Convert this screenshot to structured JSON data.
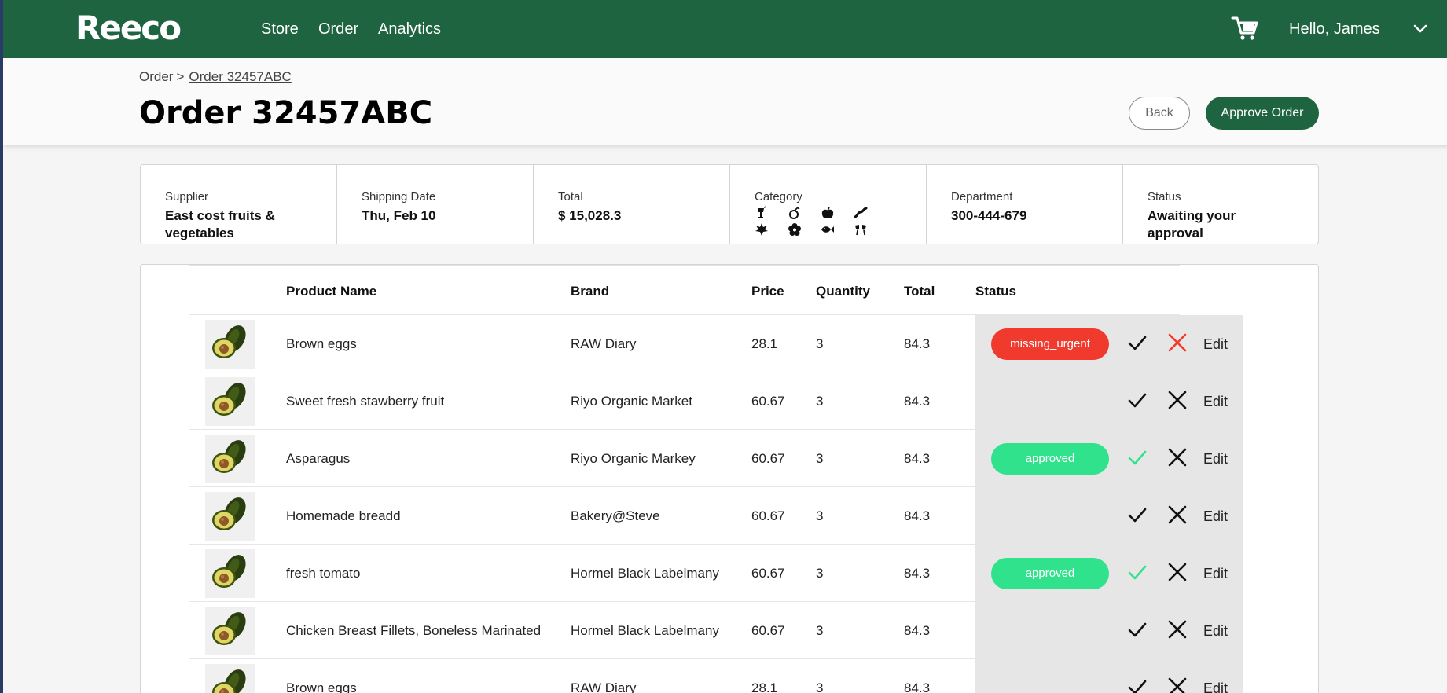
{
  "nav": {
    "logo": "Reeco",
    "links": [
      "Store",
      "Order",
      "Analytics"
    ],
    "greeting": "Hello, James"
  },
  "breadcrumb": {
    "root": "Order",
    "separator": ">",
    "current": "Order 32457ABC"
  },
  "page": {
    "title": "Order 32457ABC",
    "back_label": "Back",
    "approve_label": "Approve Order"
  },
  "summary": {
    "supplier_label": "Supplier",
    "supplier_value": "East cost fruits & vegetables",
    "shipping_label": "Shipping Date",
    "shipping_value": "Thu, Feb 10",
    "total_label": "Total",
    "total_value": "$ 15,028.3",
    "category_label": "Category",
    "category_icons": [
      "drink-icon",
      "fruit-icon",
      "apple-icon",
      "bacon-icon",
      "leaf-icon",
      "flower-icon",
      "fish-icon",
      "cheers-icon"
    ],
    "department_label": "Department",
    "department_value": "300-444-679",
    "status_label": "Status",
    "status_value": "Awaiting your approval"
  },
  "table": {
    "headers": {
      "name": "Product Name",
      "brand": "Brand",
      "price": "Price",
      "quantity": "Quantity",
      "total": "Total",
      "status": "Status"
    },
    "edit_label": "Edit",
    "rows": [
      {
        "name": "Brown eggs",
        "brand": "RAW Diary",
        "price": "28.1",
        "quantity": "3",
        "total": "84.3",
        "status": "missing_urgent"
      },
      {
        "name": "Sweet fresh stawberry fruit",
        "brand": "Riyo Organic Market",
        "price": "60.67",
        "quantity": "3",
        "total": "84.3",
        "status": ""
      },
      {
        "name": "Asparagus",
        "brand": "Riyo Organic Markey",
        "price": "60.67",
        "quantity": "3",
        "total": "84.3",
        "status": "approved"
      },
      {
        "name": "Homemade breadd",
        "brand": "Bakery@Steve",
        "price": "60.67",
        "quantity": "3",
        "total": "84.3",
        "status": ""
      },
      {
        "name": "fresh tomato",
        "brand": "Hormel Black Labelmany",
        "price": "60.67",
        "quantity": "3",
        "total": "84.3",
        "status": "approved"
      },
      {
        "name": "Chicken Breast Fillets, Boneless Marinated",
        "brand": "Hormel Black Labelmany",
        "price": "60.67",
        "quantity": "3",
        "total": "84.3",
        "status": ""
      },
      {
        "name": "Brown eggs",
        "brand": "RAW Diary",
        "price": "28.1",
        "quantity": "3",
        "total": "84.3",
        "status": ""
      }
    ]
  },
  "colors": {
    "brand_green": "#1f6441",
    "urgent_red": "#f13a2e",
    "approved_green": "#2fe28b",
    "status_bg": "#e6e6e6"
  }
}
